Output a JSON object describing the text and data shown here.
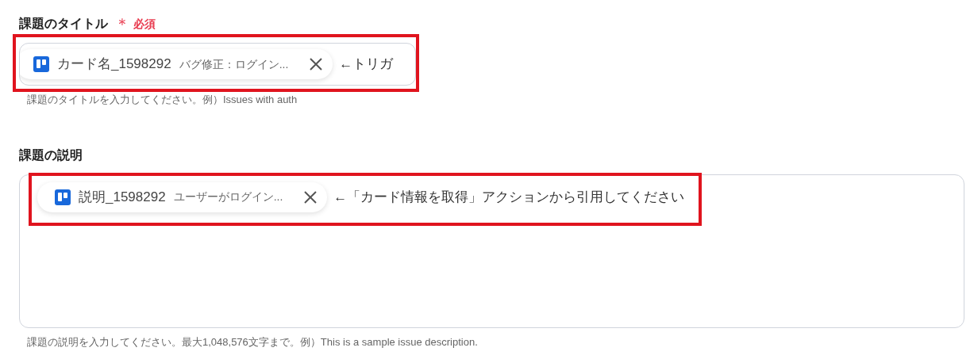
{
  "fields": [
    {
      "label": "課題のタイトル",
      "required_mark": "＊",
      "required_text": "必須",
      "tall": false,
      "chip": {
        "name": "カード名_1598292",
        "value": "バグ修正：ログイン..."
      },
      "note": "←トリガ",
      "help": "課題のタイトルを入力してください。例）Issues with auth"
    },
    {
      "label": "課題の説明",
      "tall": true,
      "chip": {
        "name": "説明_1598292",
        "value": "ユーザーがログイン..."
      },
      "note": "←「カード情報を取得」アクションから引用してください",
      "help": "課題の説明を入力してください。最大1,048,576文字まで。例）This is a sample issue description."
    }
  ]
}
